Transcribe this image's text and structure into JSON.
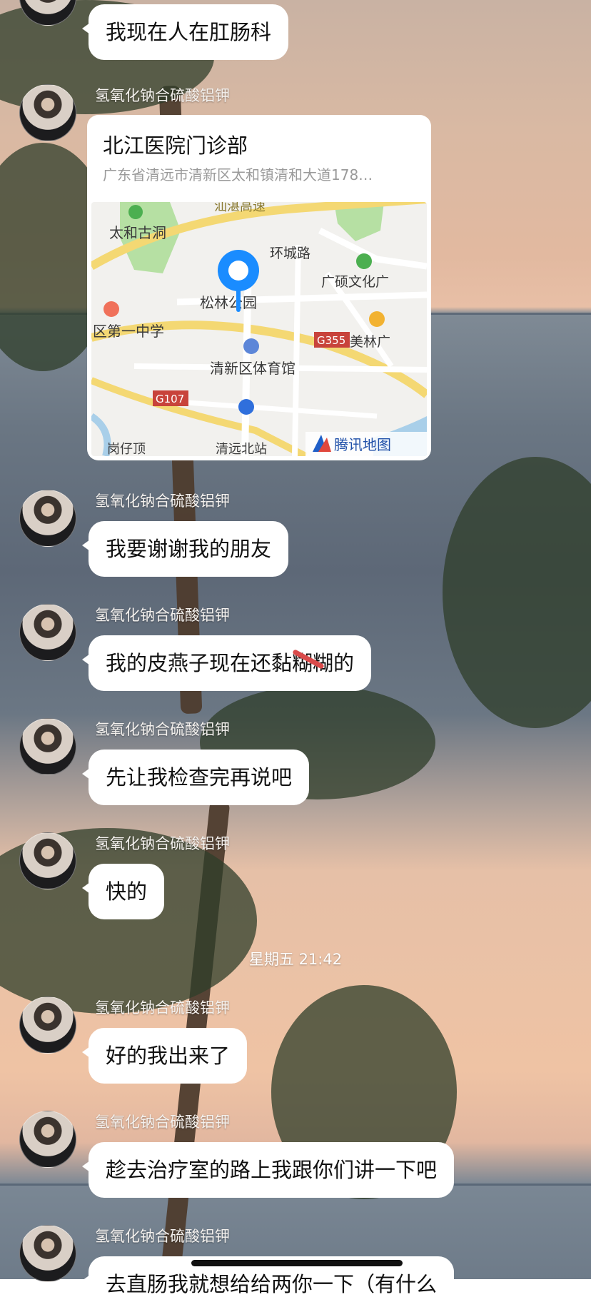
{
  "sender_name": "氢氧化钠合硫酸铝钾",
  "messages": [
    {
      "text": "我现在人在肛肠科"
    },
    {
      "text": "我要谢谢我的朋友"
    },
    {
      "text": "我的皮燕子现在还黏糊糊的"
    },
    {
      "text": "先让我检查完再说吧"
    },
    {
      "text": "快的"
    },
    {
      "text": "好的我出来了"
    },
    {
      "text": "趁去治疗室的路上我跟你们讲一下吧"
    },
    {
      "text": "去直肠我就想给给两你一下（有什么"
    }
  ],
  "location": {
    "title": "北江医院门诊部",
    "address": "广东省清远市清新区太和镇清和大道178…",
    "map": {
      "labels": {
        "expressway": "汕湛高速",
        "taihe": "太和古洞",
        "huancheng": "环城路",
        "guangshuo": "广硕文化广",
        "songlin": "松林公园",
        "school": "区第一中学",
        "g355": "G355",
        "meilin": "美林广",
        "stadium": "清新区体育馆",
        "g107": "G107",
        "gangzai": "岗仔顶",
        "station": "清远北站",
        "brand": "腾讯地图"
      }
    }
  },
  "timestamp": "星期五 21:42",
  "colors": {
    "pin": "#1a8cff",
    "map_road_yellow": "#f4d873",
    "map_green": "#b6e0a3"
  }
}
